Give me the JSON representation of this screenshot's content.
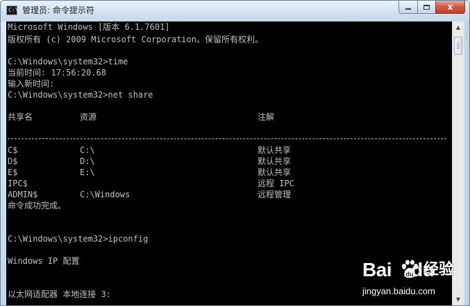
{
  "window": {
    "title": "管理员: 命令提示符",
    "app_icon_glyph": "C:\\"
  },
  "caption_buttons": {
    "close": "x"
  },
  "console": {
    "lines": [
      "Microsoft Windows [版本 6.1.7601]",
      "版权所有 (c) 2009 Microsoft Corporation。保留所有权利。",
      "",
      "C:\\Windows\\system32>time",
      "当前时间: 17:56:20.68",
      "输入新时间:",
      "C:\\Windows\\system32>net share"
    ],
    "share_headers": {
      "name": "共享名",
      "resource": "资源",
      "remark": "注解"
    },
    "shares": [
      {
        "name": "C$",
        "resource": "C:\\",
        "remark": "默认共享"
      },
      {
        "name": "D$",
        "resource": "D:\\",
        "remark": "默认共享"
      },
      {
        "name": "E$",
        "resource": "E:\\",
        "remark": "默认共享"
      },
      {
        "name": "IPC$",
        "resource": "",
        "remark": "远程 IPC"
      },
      {
        "name": "ADMIN$",
        "resource": "C:\\Windows",
        "remark": "远程管理"
      }
    ],
    "success_line": "命令成功完成。",
    "ipconfig_prompt": "C:\\Windows\\system32>ipconfig",
    "ip_config_title": "Windows IP 配置",
    "adapter_line": "以太网适配器 本地连接 3:"
  },
  "watermark": {
    "brand": "Bai",
    "brand_suffix": "du",
    "product": "经验",
    "url": "jingyan.baidu.com"
  },
  "colors": {
    "console_bg": "#000000",
    "console_text": "#c0c0c0",
    "titlebar": "#d6e4f3",
    "close_button": "#c24128"
  }
}
